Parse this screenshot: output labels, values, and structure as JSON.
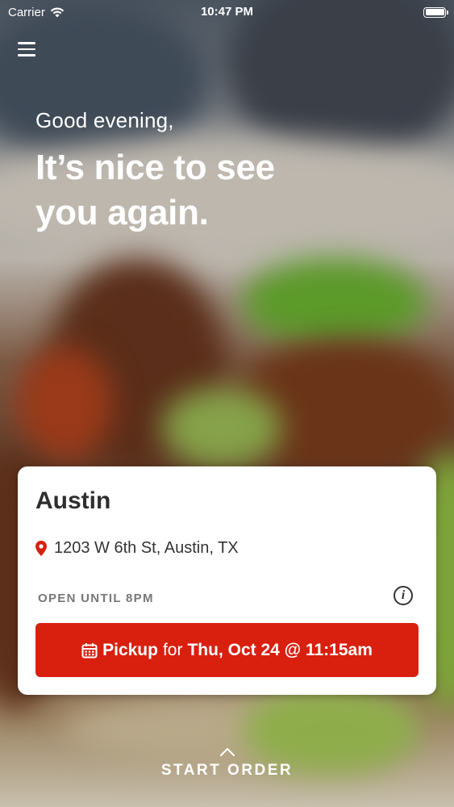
{
  "status_bar": {
    "carrier": "Carrier",
    "time": "10:47 PM"
  },
  "hero": {
    "greeting": "Good evening,",
    "headline": "It’s nice to see you again."
  },
  "location_card": {
    "name": "Austin",
    "address": "1203 W 6th St, Austin, TX",
    "hours": "OPEN UNTIL 8PM",
    "pickup": {
      "label": "Pickup",
      "connector": "for",
      "datetime": "Thu, Oct 24 @ 11:15am"
    }
  },
  "start_order": {
    "label": "START ORDER"
  },
  "colors": {
    "accent": "#d9200f",
    "card": "#ffffff",
    "pin": "#d9200f"
  },
  "icons": [
    "wifi-icon",
    "battery-icon",
    "menu-icon",
    "location-pin-icon",
    "info-icon",
    "calendar-icon",
    "chevron-up-icon"
  ]
}
